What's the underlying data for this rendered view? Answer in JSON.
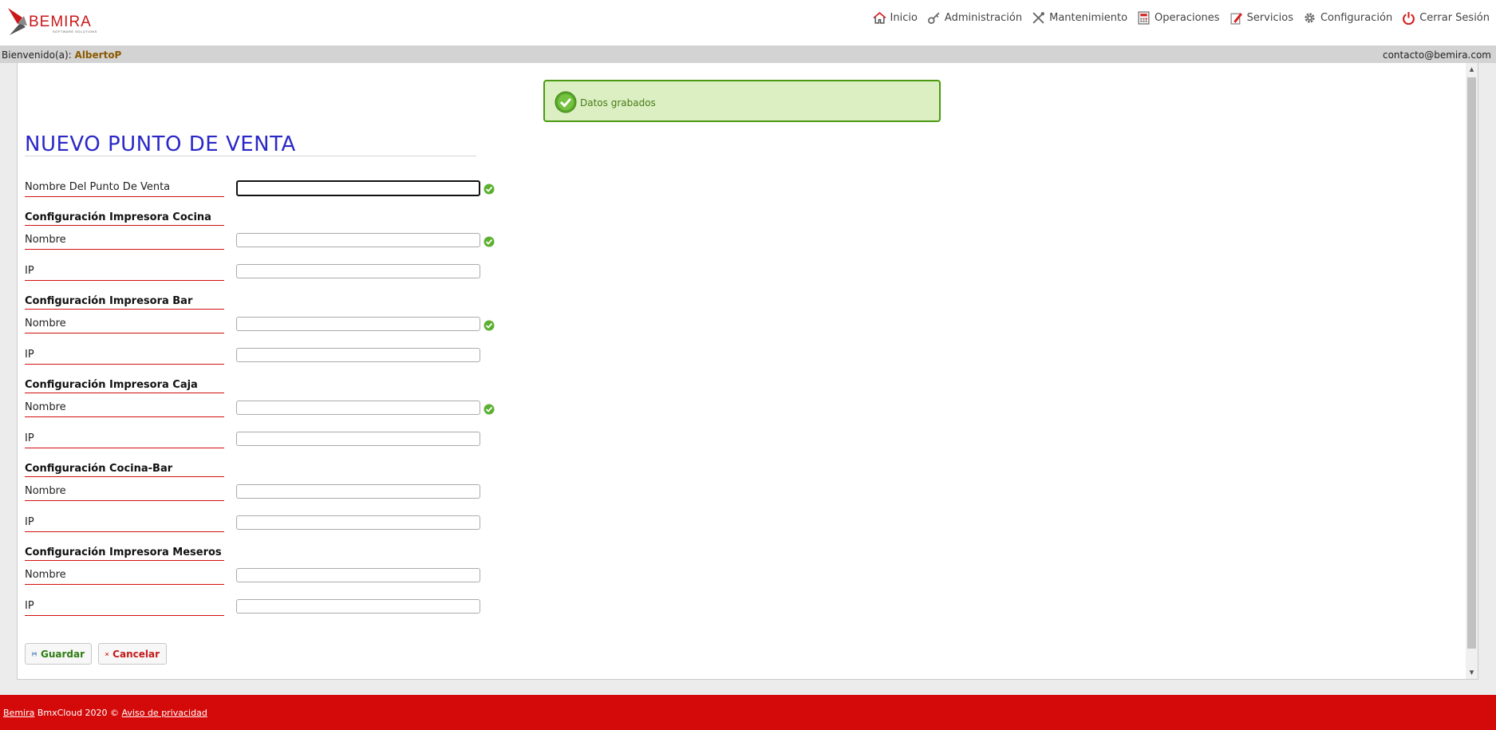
{
  "brand": {
    "name": "BEMIRA",
    "tagline": "SOFTWARE SOLUTIONS",
    "accent": "#d40a0a"
  },
  "nav": [
    {
      "label": "Inicio",
      "icon": "home-icon"
    },
    {
      "label": "Administración",
      "icon": "key-icon"
    },
    {
      "label": "Mantenimiento",
      "icon": "tools-icon"
    },
    {
      "label": "Operaciones",
      "icon": "calculator-icon"
    },
    {
      "label": "Servicios",
      "icon": "edit-icon"
    },
    {
      "label": "Configuración",
      "icon": "gear-icon"
    },
    {
      "label": "Cerrar Sesión",
      "icon": "power-icon"
    }
  ],
  "welcome": {
    "prefix": "Bienvenido(a):",
    "user": "AlbertoP",
    "email": "contacto@bemira.com"
  },
  "alert": {
    "message": "Datos grabados",
    "color": "#dbefc2"
  },
  "page": {
    "title": "NUEVO PUNTO DE VENTA"
  },
  "form": {
    "pos_name_label": "Nombre Del Punto De Venta",
    "sections": [
      {
        "title": "Configuración Impresora Cocina",
        "name_label": "Nombre",
        "ip_label": "IP"
      },
      {
        "title": "Configuración Impresora Bar",
        "name_label": "Nombre",
        "ip_label": "IP"
      },
      {
        "title": "Configuración Impresora Caja",
        "name_label": "Nombre",
        "ip_label": "IP"
      },
      {
        "title": "Configuración Cocina-Bar",
        "name_label": "Nombre",
        "ip_label": "IP"
      },
      {
        "title": "Configuración Impresora Meseros",
        "name_label": "Nombre",
        "ip_label": "IP"
      }
    ]
  },
  "buttons": {
    "save": "Guardar",
    "cancel": "Cancelar"
  },
  "footer": {
    "company": "Bemira",
    "product": "BmxCloud 2020 ©",
    "privacy": "Aviso de privacidad"
  }
}
